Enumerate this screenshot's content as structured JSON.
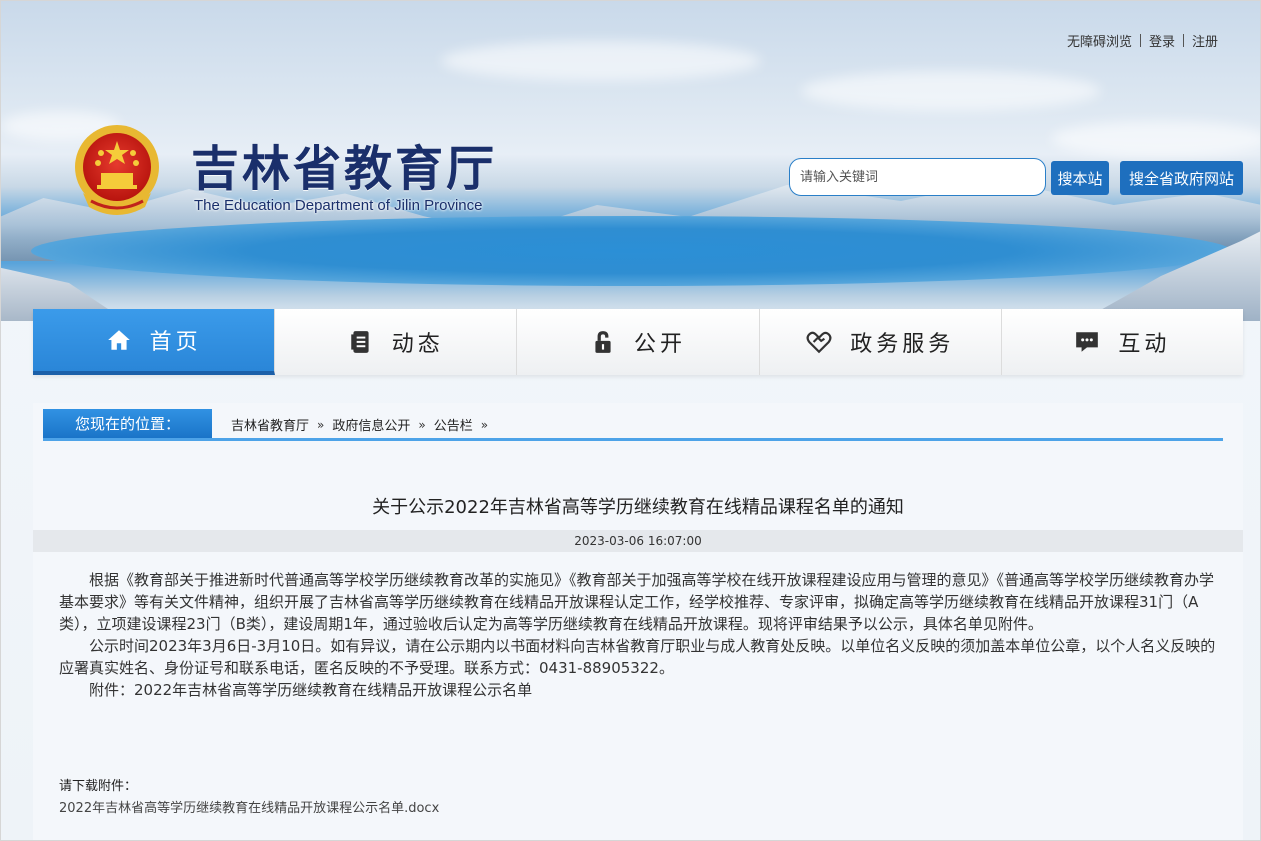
{
  "header": {
    "top_links": {
      "accessibility": "无障碍浏览",
      "login": "登录",
      "register": "注册"
    },
    "site_title": "吉林省教育厅",
    "site_subtitle": "The Education Department of Jilin Province",
    "search": {
      "placeholder": "请输入关键词",
      "search_site_label": "搜本站",
      "search_gov_label": "搜全省政府网站"
    }
  },
  "nav": {
    "items": [
      {
        "label": "首页",
        "icon": "home-icon",
        "active": true
      },
      {
        "label": "动态",
        "icon": "document-icon",
        "active": false
      },
      {
        "label": "公开",
        "icon": "lock-icon",
        "active": false
      },
      {
        "label": "政务服务",
        "icon": "handshake-heart-icon",
        "active": false
      },
      {
        "label": "互动",
        "icon": "chat-icon",
        "active": false
      }
    ]
  },
  "breadcrumb": {
    "label": "您现在的位置：",
    "items": [
      "吉林省教育厅",
      "政府信息公开",
      "公告栏"
    ],
    "separator": "»"
  },
  "article": {
    "title": "关于公示2022年吉林省高等学历继续教育在线精品课程名单的通知",
    "date": "2023-03-06 16:07:00",
    "paragraphs": [
      "根据《教育部关于推进新时代普通高等学校学历继续教育改革的实施见》《教育部关于加强高等学校在线开放课程建设应用与管理的意见》《普通高等学校学历继续教育办学基本要求》等有关文件精神，组织开展了吉林省高等学历继续教育在线精品开放课程认定工作，经学校推荐、专家评审，拟确定高等学历继续教育在线精品开放课程31门（A类），立项建设课程23门（B类），建设周期1年，通过验收后认定为高等学历继续教育在线精品开放课程。现将评审结果予以公示，具体名单见附件。",
      "公示时间2023年3月6日-3月10日。如有异议，请在公示期内以书面材料向吉林省教育厅职业与成人教育处反映。以单位名义反映的须加盖本单位公章，以个人名义反映的应署真实姓名、身份证号和联系电话，匿名反映的不予受理。联系方式：0431-88905322。",
      "附件：2022年吉林省高等学历继续教育在线精品开放课程公示名单"
    ],
    "download_label": "请下载附件：",
    "download_file": "2022年吉林省高等学历继续教育在线精品开放课程公示名单.docx"
  },
  "colors": {
    "title_navy": "#1a2f6b",
    "nav_active": "#2a86d8",
    "button_blue": "#1e6fbe",
    "breadcrumb_blue": "#1a74c8"
  }
}
